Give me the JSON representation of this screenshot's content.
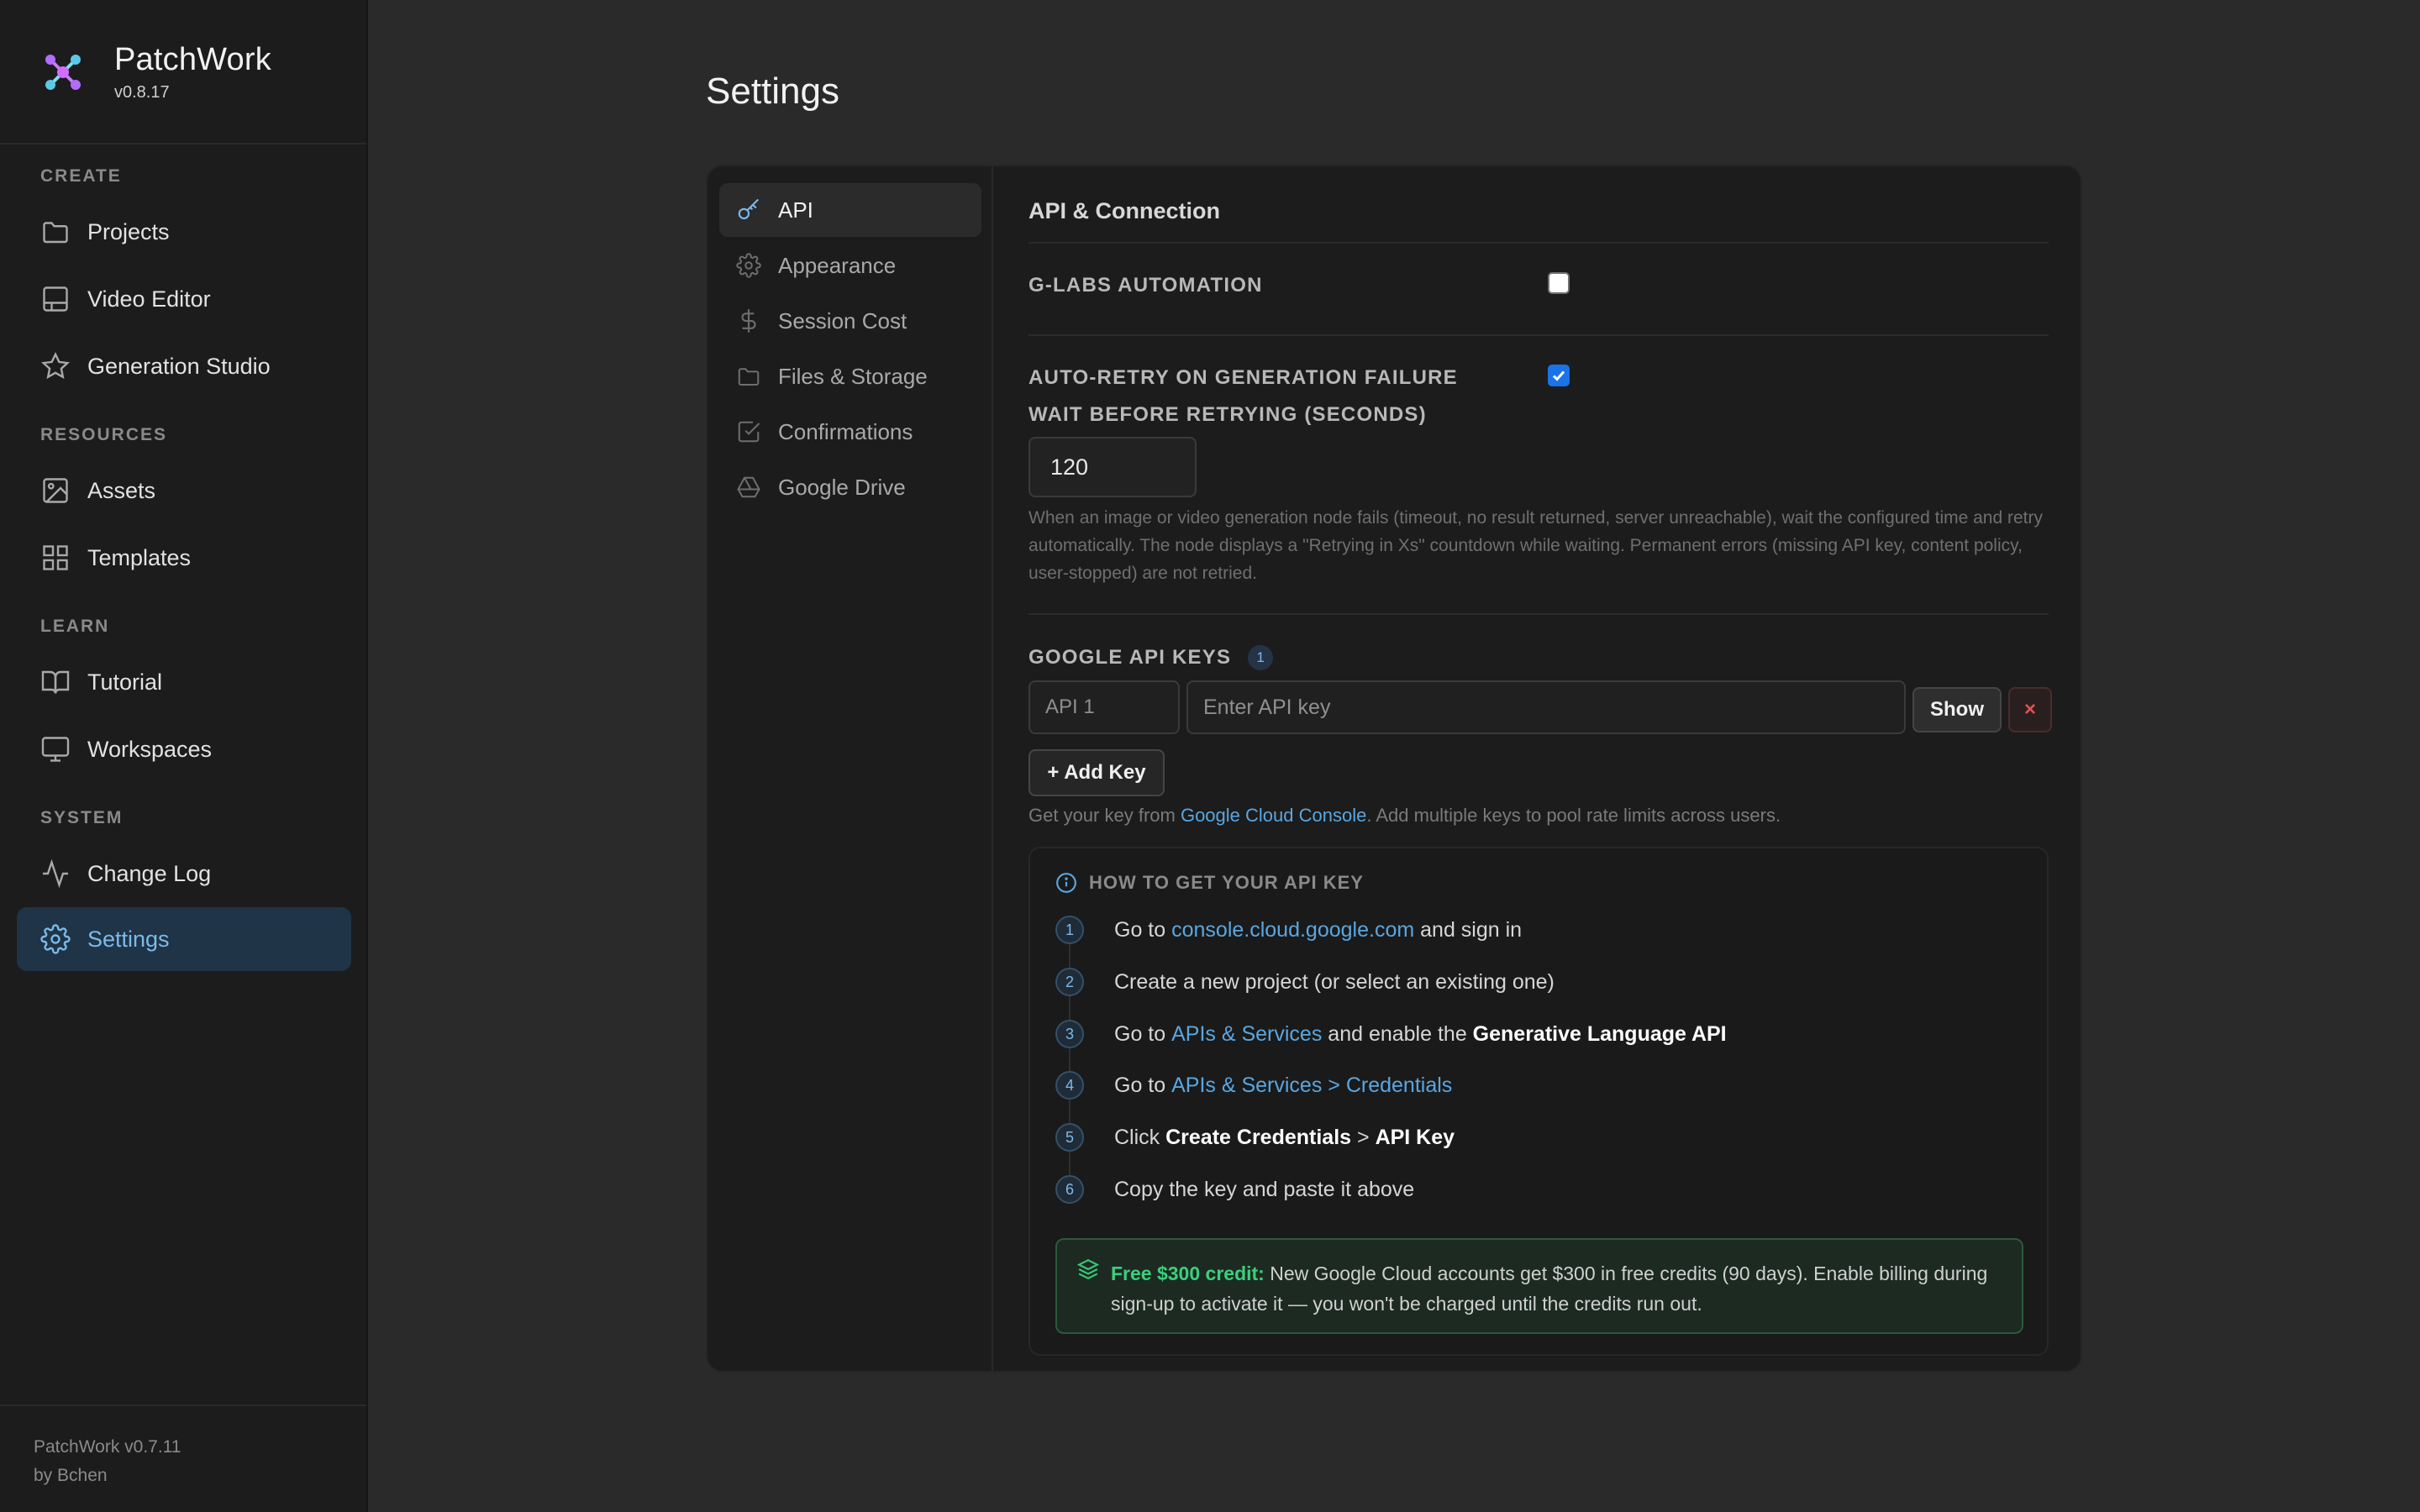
{
  "app": {
    "name": "PatchWork",
    "version": "v0.8.17"
  },
  "sidebar": {
    "sections": {
      "create": "CREATE",
      "resources": "RESOURCES",
      "learn": "LEARN",
      "system": "SYSTEM"
    },
    "items": [
      {
        "label": "Projects",
        "icon": "folder-icon"
      },
      {
        "label": "Video Editor",
        "icon": "layout-icon"
      },
      {
        "label": "Generation Studio",
        "icon": "star-icon"
      },
      {
        "label": "Assets",
        "icon": "image-icon"
      },
      {
        "label": "Templates",
        "icon": "grid-icon"
      },
      {
        "label": "Tutorial",
        "icon": "book-icon"
      },
      {
        "label": "Workspaces",
        "icon": "monitor-icon"
      },
      {
        "label": "Change Log",
        "icon": "activity-icon"
      },
      {
        "label": "Settings",
        "icon": "gear-icon",
        "active": true
      }
    ],
    "footer": {
      "version": "PatchWork v0.7.11",
      "author": "by Bchen"
    }
  },
  "page": {
    "title": "Settings"
  },
  "settings_nav": [
    {
      "label": "API",
      "icon": "key-icon",
      "active": true
    },
    {
      "label": "Appearance",
      "icon": "gear-icon"
    },
    {
      "label": "Session Cost",
      "icon": "dollar-icon"
    },
    {
      "label": "Files & Storage",
      "icon": "folder-icon"
    },
    {
      "label": "Confirmations",
      "icon": "check-square-icon"
    },
    {
      "label": "Google Drive",
      "icon": "drive-icon"
    }
  ],
  "api": {
    "section_title": "API & Connection",
    "glabs": {
      "label": "G-LABS AUTOMATION",
      "checked": false
    },
    "auto_retry": {
      "label": "AUTO-RETRY ON GENERATION FAILURE",
      "checked": true
    },
    "wait": {
      "label": "WAIT BEFORE RETRYING (SECONDS)",
      "value": "120"
    },
    "help_text": "When an image or video generation node fails (timeout, no result returned, server unreachable), wait the configured time and retry automatically. The node displays a \"Retrying in Xs\" countdown while waiting. Permanent errors (missing API key, content policy, user-stopped) are not retried.",
    "keys": {
      "label": "GOOGLE API KEYS",
      "count": "1",
      "rows": [
        {
          "name": "API 1",
          "placeholder": "Enter API key"
        }
      ],
      "show_label": "Show",
      "remove_label": "×",
      "add_label": "+ Add Key",
      "help_prefix": "Get your key from ",
      "help_link": "Google Cloud Console",
      "help_suffix": ". Add multiple keys to pool rate limits across users."
    },
    "howto": {
      "title": "HOW TO GET YOUR API KEY",
      "steps": [
        {
          "num": "1",
          "a": "Go to ",
          "link": "console.cloud.google.com",
          "b": " and sign in"
        },
        {
          "num": "2",
          "a": "Create a new project (or select an existing one)"
        },
        {
          "num": "3",
          "a": "Go to ",
          "link": "APIs & Services",
          "b": " and enable the ",
          "bold": "Generative Language API"
        },
        {
          "num": "4",
          "a": "Go to ",
          "link": "APIs & Services > Credentials"
        },
        {
          "num": "5",
          "a": "Click ",
          "bold": "Create Credentials",
          "b": " > ",
          "bold2": "API Key"
        },
        {
          "num": "6",
          "a": "Copy the key and paste it above"
        }
      ],
      "credit_highlight": "Free $300 credit:",
      "credit_text": " New Google Cloud accounts get $300 in free credits (90 days). Enable billing during sign-up to activate it — you won't be charged until the credits run out."
    }
  },
  "colors": {
    "accent": "#7cb9ea",
    "link": "#5aa6e0",
    "success": "#3ad07c",
    "danger": "#e05252"
  }
}
